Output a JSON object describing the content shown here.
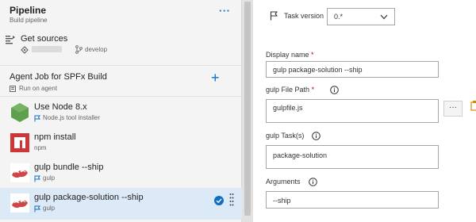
{
  "pipeline": {
    "title": "Pipeline",
    "subtitle": "Build pipeline",
    "more": "···"
  },
  "get_sources": {
    "title": "Get sources",
    "branch": "develop"
  },
  "agent_job": {
    "title": "Agent Job for SPFx Build",
    "subtitle": "Run on agent",
    "add": "+"
  },
  "tasks": [
    {
      "title": "Use Node 8.x",
      "subtitle": "Node.js tool installer",
      "icon": "nodejs-icon",
      "selected": false
    },
    {
      "title": "npm install",
      "subtitle": "npm",
      "icon": "npm-icon",
      "selected": false
    },
    {
      "title": "gulp bundle --ship",
      "subtitle": "gulp",
      "icon": "gulp-icon",
      "selected": false
    },
    {
      "title": "gulp package-solution --ship",
      "subtitle": "gulp",
      "icon": "gulp-icon",
      "selected": true
    }
  ],
  "details": {
    "task_version_label": "Task version",
    "task_version_value": "0.*",
    "display_name_label": "Display name",
    "display_name_value": "gulp package-solution --ship",
    "gulp_file_label": "gulp File Path",
    "gulp_file_value": "gulpfile.js",
    "gulp_tasks_label": "gulp Task(s)",
    "gulp_tasks_value": "package-solution",
    "arguments_label": "Arguments",
    "arguments_value": "--ship",
    "required_mark": "*",
    "browse_label": "···"
  },
  "colors": {
    "accent": "#106ebe",
    "selected_bg": "#dceaf8",
    "required": "#c70000",
    "node_green": "#5fa04e",
    "npm_red": "#cb3837",
    "gulp_red": "#cf4647"
  }
}
